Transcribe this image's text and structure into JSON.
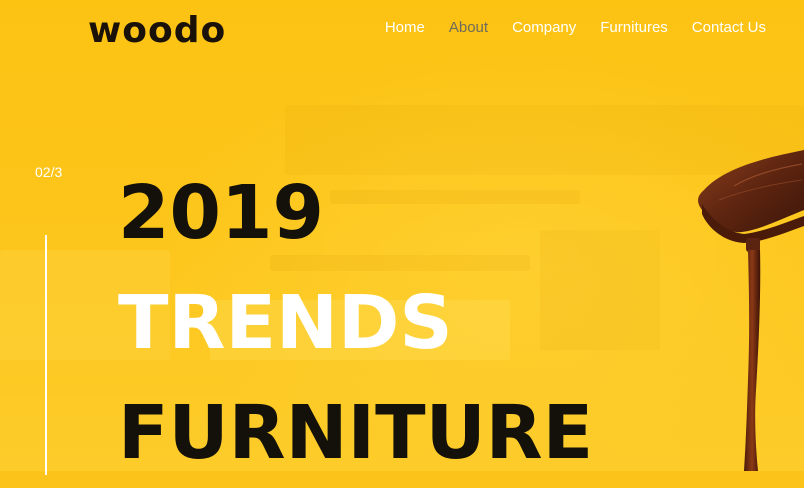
{
  "brand": {
    "logo_text": "woodo"
  },
  "nav": {
    "items": [
      {
        "label": "Home",
        "active": false
      },
      {
        "label": "About",
        "active": true
      },
      {
        "label": "Company",
        "active": false
      },
      {
        "label": "Furnitures",
        "active": false
      },
      {
        "label": "Contact Us",
        "active": false
      }
    ]
  },
  "hero": {
    "slide_counter": "02/3",
    "headline_line1": "2019",
    "headline_line2": "TRENDS",
    "headline_line3": "FURNITURE",
    "image_icon": "wooden-side-table"
  },
  "colors": {
    "background": "#fcc41a",
    "headline_dark": "#14110a",
    "headline_light": "#ffffff",
    "nav_active": "#6f6a5c"
  }
}
